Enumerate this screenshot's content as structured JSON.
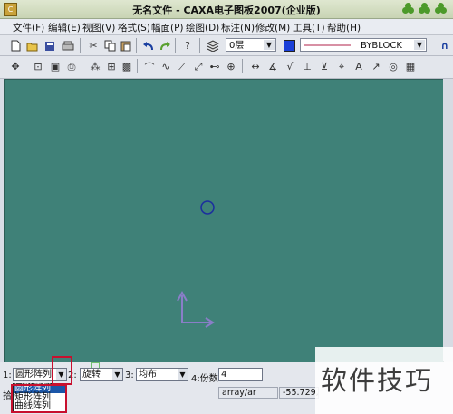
{
  "window": {
    "title": "无名文件 - CAXA电子图板2007(企业版)"
  },
  "menu": [
    "文件(F)",
    "编辑(E)",
    "视图(V)",
    "格式(S)",
    "幅面(P)",
    "绘图(D)",
    "标注(N)",
    "修改(M)",
    "工具(T)",
    "帮助(H)"
  ],
  "toolbar": {
    "layer": "0层",
    "linetype": "BYBLOCK",
    "color": "#1a3fd8"
  },
  "command": {
    "opt1_num": "1:",
    "opt1_value": "圆形阵列",
    "opt2_num": "2:",
    "opt2_value": "旋转",
    "opt3_num": "3:",
    "opt3_value": "均布",
    "opt4_label": "4:份数",
    "opt4_value": "4",
    "prompt": "拾"
  },
  "dropdown": {
    "options": [
      "圆形阵列",
      "矩形阵列",
      "曲线阵列"
    ]
  },
  "status": {
    "command_name": "array/ar",
    "coordinates": "-55.729,-"
  },
  "watermark": "软件技巧"
}
